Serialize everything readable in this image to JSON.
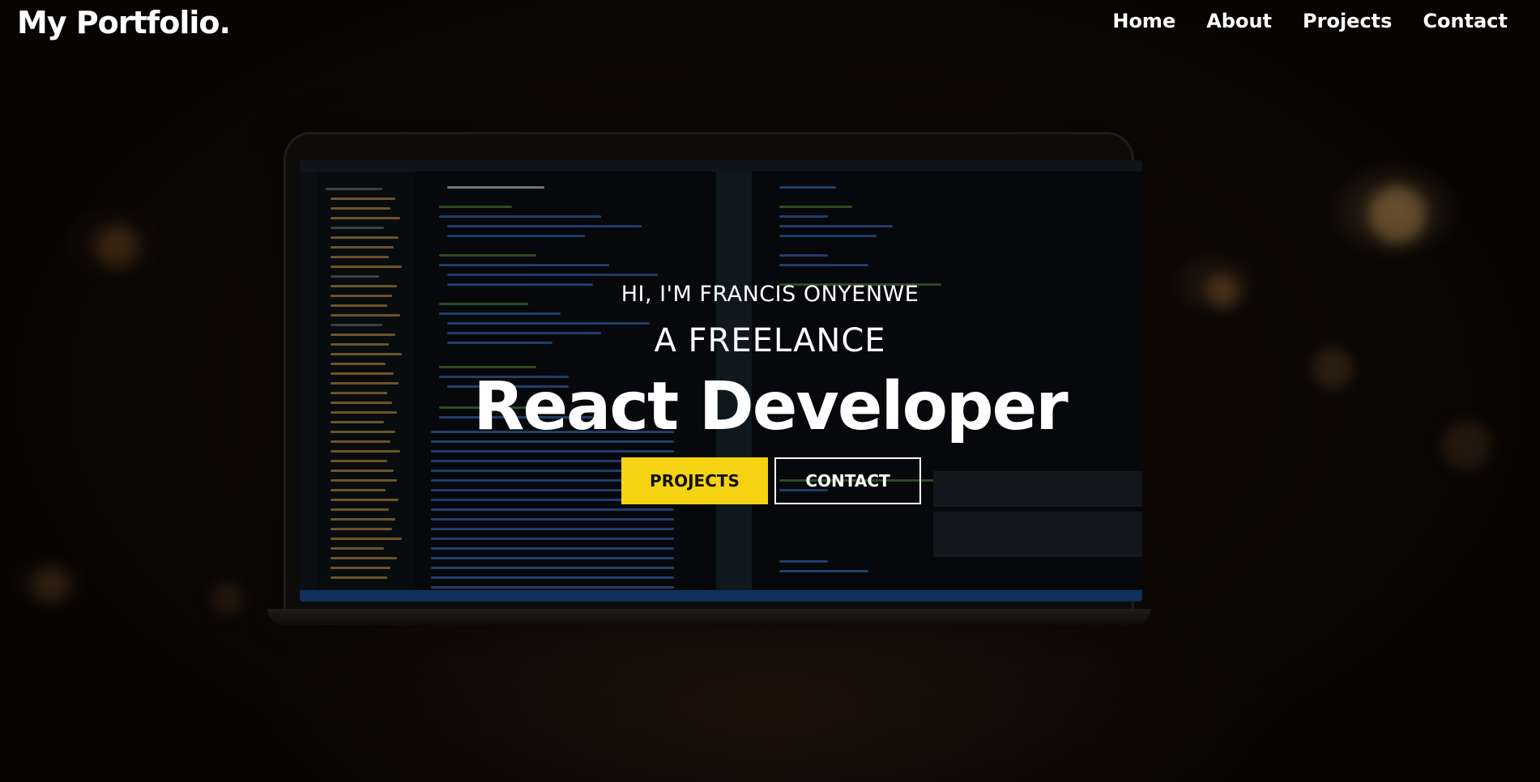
{
  "header": {
    "logo": "My Portfolio.",
    "nav": [
      {
        "label": "Home"
      },
      {
        "label": "About"
      },
      {
        "label": "Projects"
      },
      {
        "label": "Contact"
      }
    ]
  },
  "hero": {
    "intro": "HI, I'M FRANCIS ONYENWE",
    "role_prefix": "A FREELANCE",
    "role": "React Developer",
    "buttons": {
      "projects": "PROJECTS",
      "contact": "CONTACT"
    }
  },
  "colors": {
    "accent": "#f6d312",
    "text": "#ffffff",
    "background": "#120c07"
  },
  "icons": []
}
